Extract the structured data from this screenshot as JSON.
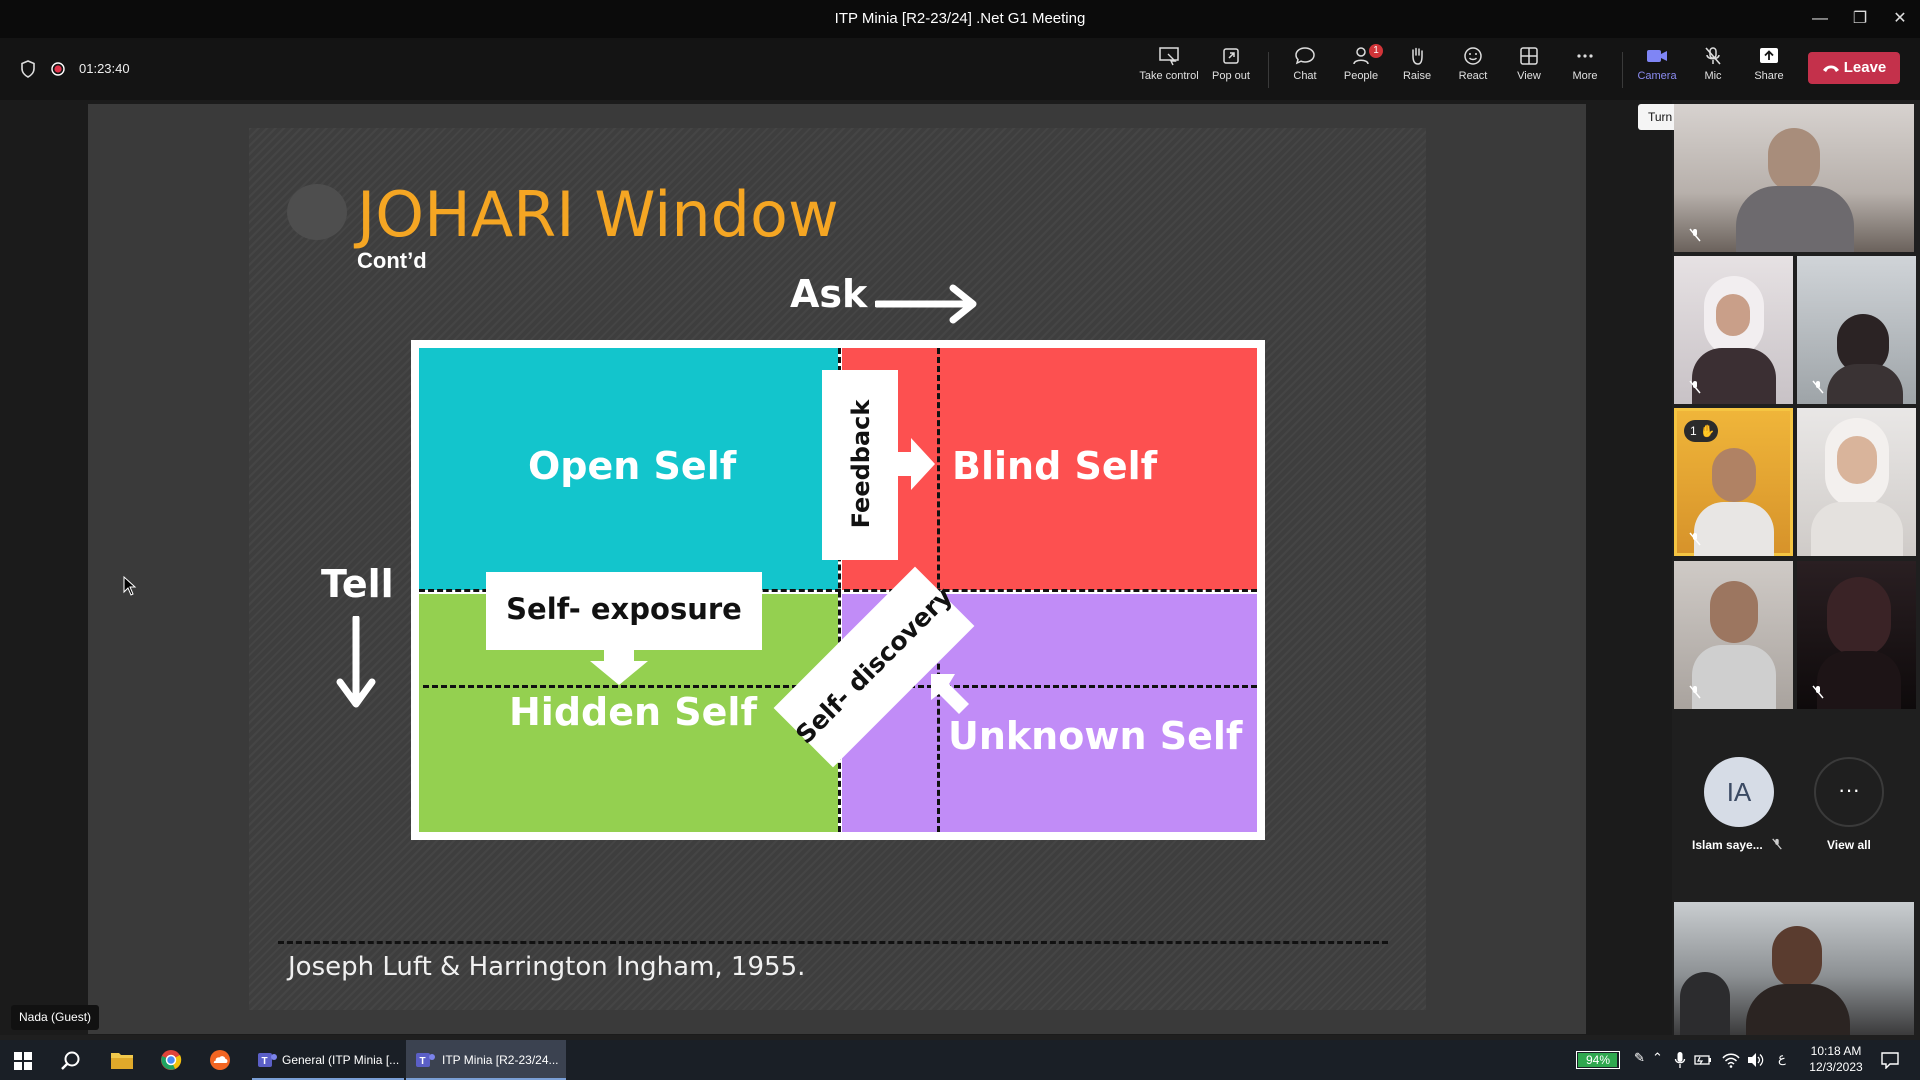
{
  "window": {
    "title": "ITP Minia [R2-23/24] .Net G1 Meeting",
    "minimize": "—",
    "restore": "❐",
    "close": "✕"
  },
  "meeting": {
    "timer": "01:23:40"
  },
  "toolbar": {
    "take_control": "Take control",
    "pop_out": "Pop out",
    "chat": "Chat",
    "people": "People",
    "people_badge": "1",
    "raise": "Raise",
    "react": "React",
    "view": "View",
    "more": "More",
    "camera": "Camera",
    "mic": "Mic",
    "share": "Share",
    "leave": "Leave"
  },
  "tooltip": "Turn camera off (Ctrl+Shift+O)",
  "slide": {
    "title": "JOHARI Window",
    "subtitle": "Cont’d",
    "ask": "Ask",
    "tell": "Tell",
    "open_self": "Open Self",
    "blind_self": "Blind Self",
    "hidden_self": "Hidden Self",
    "unknown_self": "Unknown Self",
    "feedback": "Feedback",
    "self_exposure": "Self- exposure",
    "self_discovery": "Self- discovery",
    "citation": "Joseph Luft & Harrington Ingham, 1955.",
    "colors": {
      "open": "#13c5cc",
      "blind": "#fd5050",
      "hidden": "#94d050",
      "unknown": "#c18cf7",
      "title": "#f5a623"
    }
  },
  "presenter_name": "Nada (Guest)",
  "participants": {
    "raised_hand_order": "1",
    "avatar_initials": "IA",
    "avatar_name": "Islam saye...",
    "view_all": "View all"
  },
  "taskbar": {
    "app1": "General (ITP Minia [...",
    "app2": "ITP Minia [R2-23/24...",
    "battery": "94%",
    "time": "10:18 AM",
    "date": "12/3/2023"
  }
}
